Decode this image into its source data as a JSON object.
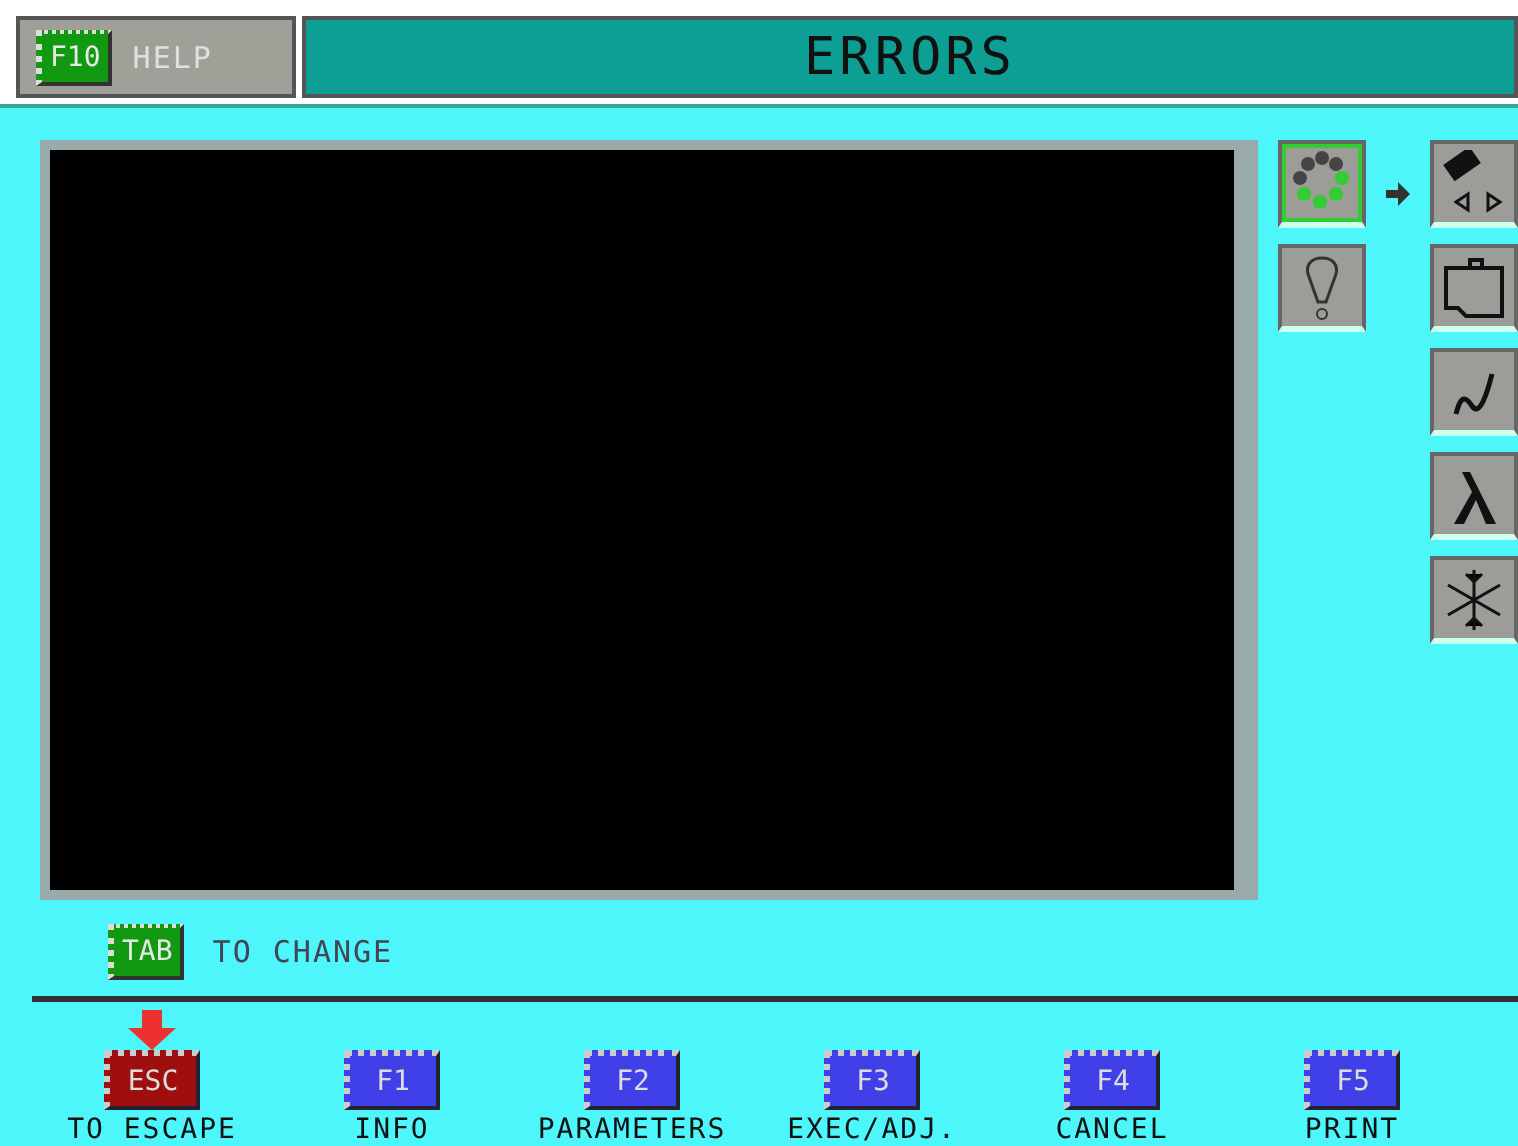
{
  "help": {
    "key": "F10",
    "label": "HELP"
  },
  "title": "ERRORS",
  "side_icons": [
    {
      "kind": "dots",
      "active": true
    },
    {
      "kind": "bulb",
      "active": false
    }
  ],
  "system_icons": [
    {
      "kind": "chip"
    },
    {
      "kind": "engine"
    },
    {
      "kind": "hose"
    },
    {
      "kind": "lambda"
    },
    {
      "kind": "snow"
    }
  ],
  "tab_hint": {
    "key": "TAB",
    "label": "TO CHANGE"
  },
  "keys": [
    {
      "key": "ESC",
      "label": "TO ESCAPE",
      "kind": "esc",
      "selected": true
    },
    {
      "key": "F1",
      "label": "INFO",
      "kind": "f",
      "selected": false
    },
    {
      "key": "F2",
      "label": "PARAMETERS",
      "kind": "f",
      "selected": false
    },
    {
      "key": "F3",
      "label": "EXEC/ADJ.",
      "kind": "f",
      "selected": false
    },
    {
      "key": "F4",
      "label": "CANCEL",
      "kind": "f",
      "selected": false
    },
    {
      "key": "F5",
      "label": "PRINT",
      "kind": "f",
      "selected": false
    }
  ]
}
